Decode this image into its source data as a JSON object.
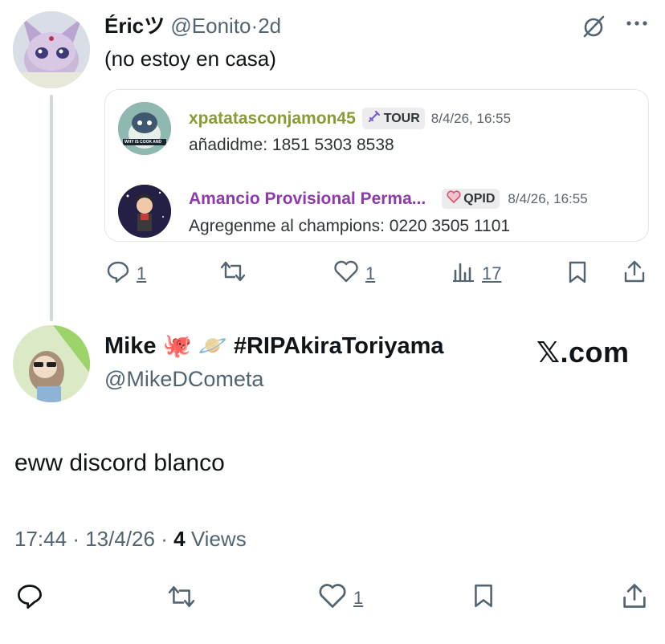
{
  "tweet1": {
    "display_name": "Éricツ",
    "handle": "@Eonito",
    "separator": "·",
    "age": "2d",
    "text": "(no estoy en casa)",
    "replies": "1",
    "likes": "1",
    "views": "17",
    "embed": {
      "messages": [
        {
          "username": "xpatatasconjamon45",
          "username_color": "#8a9b36",
          "badge": "TOUR",
          "badge_icon": "sword-icon",
          "time": "8/4/26, 16:55",
          "text": "añadidme: 1851 5303 8538",
          "avatar_text": "WHY IS COOK AND"
        },
        {
          "username": "Amancio Provisional Perma...",
          "username_color": "#8e3aa9",
          "badge": "QPID",
          "badge_icon": "heart-icon",
          "time": "8/4/26, 16:55",
          "text": "Agregenme al champions: 0220 3505 1101"
        }
      ]
    }
  },
  "tweet2": {
    "display_name": "Mike 🐙 🪐 #RIPAkiraToriyama",
    "handle": "@MikeDCometa",
    "text": "eww discord blanco",
    "time": "17:44",
    "date": "13/4/26",
    "separator": "·",
    "views_count": "4",
    "views_label": "Views",
    "likes": "1"
  },
  "watermark": "𝕏.com",
  "colors": {
    "text_primary": "#0f1419",
    "text_muted": "#536471",
    "thread_line": "#cfd9de"
  }
}
